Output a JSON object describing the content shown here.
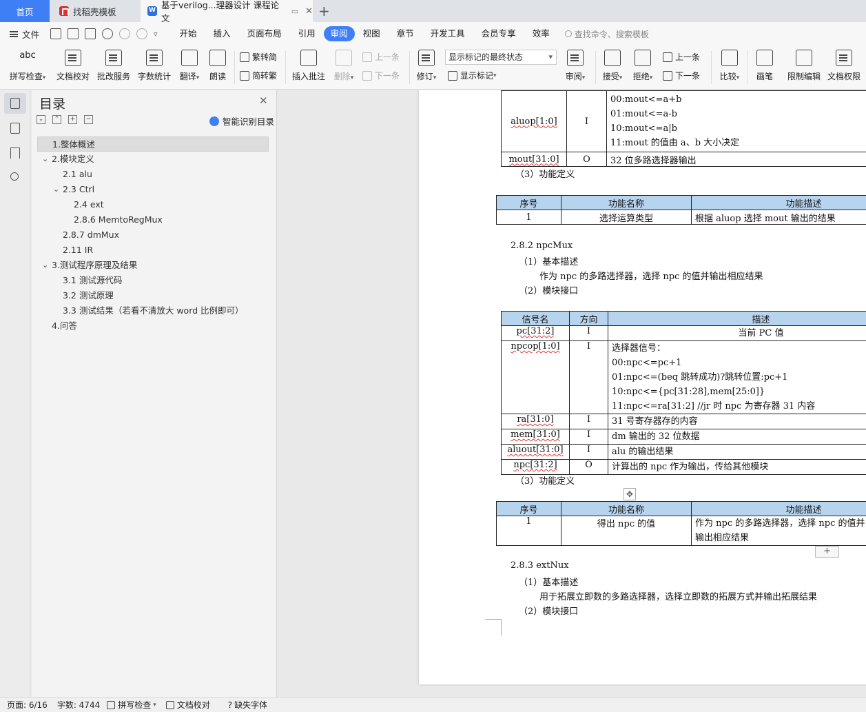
{
  "tabs": {
    "home": "首页",
    "template": "找稻壳模板",
    "doc": "基于verilog...理器设计 课程论文"
  },
  "menubar": {
    "file": "文件",
    "items": [
      "开始",
      "插入",
      "页面布局",
      "引用",
      "审阅",
      "视图",
      "章节",
      "开发工具",
      "会员专享",
      "效率"
    ],
    "active": "审阅",
    "search_placeholder": "查找命令、搜索模板"
  },
  "ribbon": {
    "spell_check": "拼写检查",
    "doc_proof": "文档校对",
    "batch_service": "批改服务",
    "word_count": "字数统计",
    "translate": "翻译",
    "read_aloud": "朗读",
    "trad_to_simp": "繁转简",
    "simp_to_trad": "简转繁",
    "insert_comment": "插入批注",
    "delete": "删除",
    "prev": "上一条",
    "next": "下一条",
    "track_changes": "修订",
    "markup_state": "显示标记的最终状态",
    "show_markup": "显示标记",
    "review": "审阅",
    "accept": "接受",
    "reject": "拒绝",
    "prev2": "上一条",
    "next2": "下一条",
    "compare": "比较",
    "pen": "画笔",
    "restrict_edit": "限制编辑",
    "doc_permission": "文档权限"
  },
  "toc": {
    "title": "目录",
    "smart": "智能识别目录",
    "items": [
      {
        "label": "1.整体概述",
        "level": 1,
        "expanded": null,
        "selected": true
      },
      {
        "label": "2.模块定义",
        "level": 1,
        "expanded": true,
        "selected": false
      },
      {
        "label": "2.1 alu",
        "level": 2,
        "expanded": null,
        "selected": false
      },
      {
        "label": "2.3 Ctrl",
        "level": 2,
        "expanded": true,
        "selected": false
      },
      {
        "label": "2.4 ext",
        "level": 3,
        "expanded": null,
        "selected": false
      },
      {
        "label": "2.8.6 MemtoRegMux",
        "level": 3,
        "expanded": null,
        "selected": false
      },
      {
        "label": "2.8.7 dmMux",
        "level": 2,
        "expanded": null,
        "selected": false
      },
      {
        "label": "2.11 IR",
        "level": 2,
        "expanded": null,
        "selected": false
      },
      {
        "label": "3.测试程序原理及结果",
        "level": 1,
        "expanded": true,
        "selected": false
      },
      {
        "label": "3.1 测试源代码",
        "level": 2,
        "expanded": null,
        "selected": false
      },
      {
        "label": "3.2 测试原理",
        "level": 2,
        "expanded": null,
        "selected": false
      },
      {
        "label": "3.3 测试结果（若看不清放大 word 比例即可）",
        "level": 2,
        "expanded": null,
        "selected": false
      },
      {
        "label": "4.问答",
        "level": 1,
        "expanded": null,
        "selected": false
      }
    ]
  },
  "page": {
    "t1": {
      "aluop_name": "aluop[1:0]",
      "aluop_dir": "I",
      "aluop_desc": [
        "00:mout<=a+b",
        "01:mout<=a-b",
        "10:mout<=a|b",
        "11:mout 的值由 a、b 大小决定"
      ],
      "mout_name": "mout[31:0]",
      "mout_dir": "O",
      "mout_desc": "32 位多路选择器输出"
    },
    "func_def_1": "（3）功能定义",
    "t2": {
      "headers": [
        "序号",
        "功能名称",
        "功能描述"
      ],
      "row": [
        "1",
        "选择运算类型",
        "根据 aluop 选择 mout 输出的结果"
      ]
    },
    "sec_npcmux": "2.8.2 npcMux",
    "basic_desc_1": "（1）基本描述",
    "npcmux_desc": "作为 npc 的多路选择器，选择 npc 的值并输出相应结果",
    "port_1": "（2）模块接口",
    "t3": {
      "headers": [
        "信号名",
        "方向",
        "描述"
      ],
      "rows": [
        {
          "name": "pc[31:2]",
          "dir": "I",
          "desc": [
            "当前 PC 值"
          ]
        },
        {
          "name": "npcop[1:0]",
          "dir": "I",
          "desc": [
            "选择器信号：",
            "00:npc<=pc+1",
            "01:npc<=(beq 跳转成功)?跳转位置:pc+1",
            "10:npc<={pc[31:28],mem[25:0]}",
            "11:npc<=ra[31:2] //jr 时 npc 为寄存器 31 内容"
          ]
        },
        {
          "name": "ra[31:0]",
          "dir": "I",
          "desc": [
            "31 号寄存器存的内容"
          ]
        },
        {
          "name": "mem[31:0]",
          "dir": "I",
          "desc": [
            "dm 输出的 32 位数据"
          ]
        },
        {
          "name": "aluout[31:0]",
          "dir": "I",
          "desc": [
            "alu 的输出结果"
          ]
        },
        {
          "name": "npc[31:2]",
          "dir": "O",
          "desc": [
            "计算出的 npc 作为输出，传给其他模块"
          ]
        }
      ]
    },
    "func_def_2": "（3）功能定义",
    "t4": {
      "headers": [
        "序号",
        "功能名称",
        "功能描述"
      ],
      "row": [
        "1",
        "得出 npc 的值",
        "作为 npc 的多路选择器，选择 npc 的值并",
        "输出相应结果"
      ]
    },
    "sec_extnux": "2.8.3 extNux",
    "basic_desc_2": "（1）基本描述",
    "extnux_desc": "用于拓展立即数的多路选择器，选择立即数的拓展方式并输出拓展结果",
    "port_2": "（2）模块接口"
  },
  "status": {
    "page": "页面: 6/16",
    "words": "字数: 4744",
    "spell": "拼写检查",
    "proof": "文档校对",
    "missing_font": "缺失字体"
  }
}
